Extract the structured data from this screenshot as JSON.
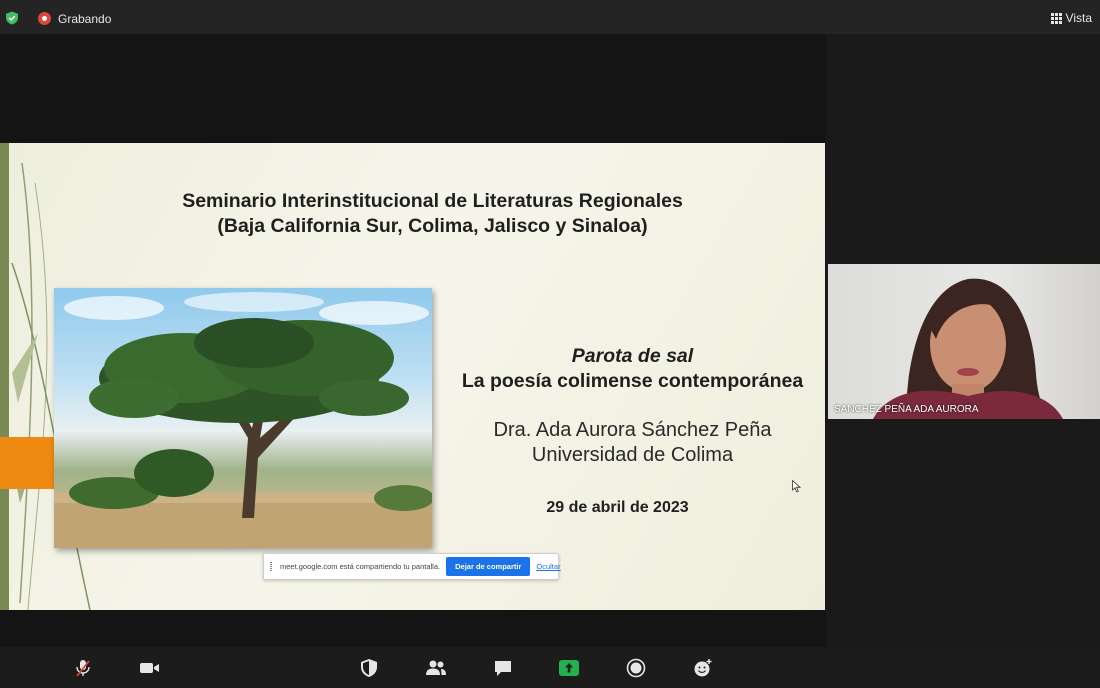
{
  "topbar": {
    "recording_label": "Grabando",
    "view_label": "Vista",
    "colors": {
      "recording": "#e0453b",
      "shield": "#3fbf5f"
    }
  },
  "slide": {
    "title_line1": "Seminario Interinstitucional de Literaturas Regionales",
    "title_line2": "(Baja California Sur, Colima, Jalisco y Sinaloa)",
    "poem_title": "Parota de sal",
    "poem_subtitle": "La poesía colimense contemporánea",
    "author": "Dra. Ada Aurora Sánchez Peña",
    "university": "Universidad de Colima",
    "date": "29 de abril de 2023",
    "accent_color": "#ee8a12"
  },
  "share_banner": {
    "message": "meet.google.com está compartiendo tu pantalla.",
    "stop_label": "Dejar de compartir",
    "hide_label": "Ocultar"
  },
  "participant": {
    "name": "SANCHEZ PEÑA ADA AURORA"
  },
  "toolbar": {
    "icons": [
      "microphone-muted-icon",
      "camera-icon",
      "security-shield-icon",
      "participants-icon",
      "chat-icon",
      "share-screen-icon",
      "record-icon",
      "reactions-icon"
    ],
    "share_color": "#23b14d"
  }
}
